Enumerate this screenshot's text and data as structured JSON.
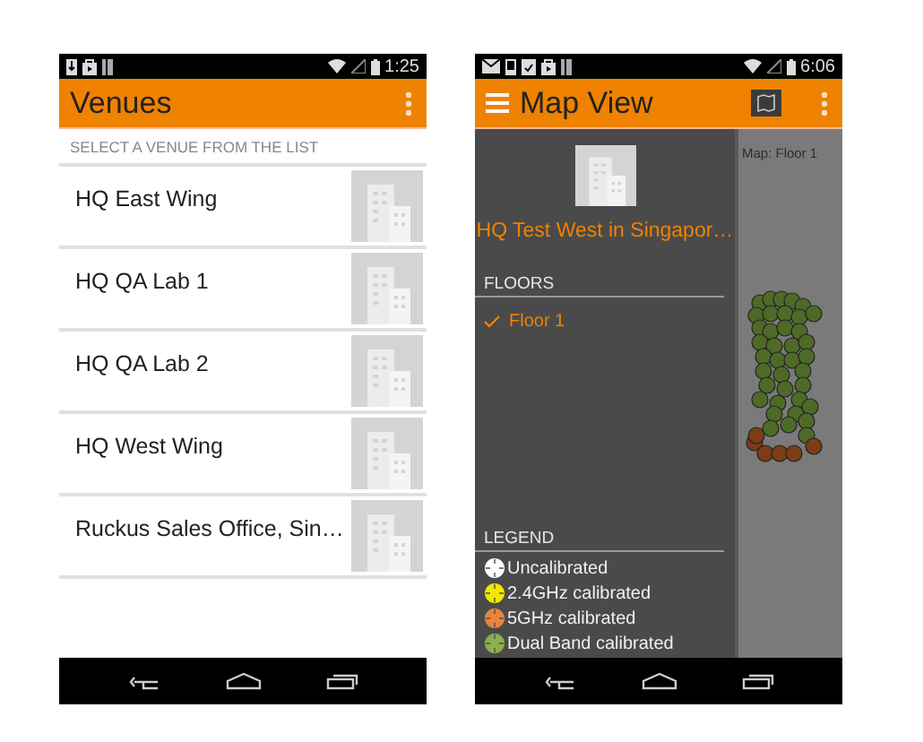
{
  "screens": [
    {
      "kind": "venue-list",
      "status_bar": {
        "time": "1:25"
      },
      "app_bar": {
        "title": "Venues"
      },
      "subtitle": "SELECT A VENUE FROM THE LIST",
      "venues": [
        {
          "name": "HQ East Wing"
        },
        {
          "name": "HQ QA Lab 1"
        },
        {
          "name": "HQ QA Lab 2"
        },
        {
          "name": "HQ West Wing"
        },
        {
          "name": "Ruckus Sales Office, Sin…"
        }
      ]
    },
    {
      "kind": "map-view",
      "status_bar": {
        "time": "6:06"
      },
      "app_bar": {
        "title": "Map View"
      },
      "map_label": "Map: Floor 1",
      "drawer": {
        "venue": "HQ Test West in Singapor…",
        "floors_heading": "FLOORS",
        "floors": [
          {
            "label": "Floor 1",
            "selected": true
          }
        ],
        "legend_heading": "LEGEND",
        "legend": [
          {
            "label": "Uncalibrated",
            "color": "#ffffff"
          },
          {
            "label": "2.4GHz calibrated",
            "color": "#f2e600"
          },
          {
            "label": "5GHz calibrated",
            "color": "#e8843c"
          },
          {
            "label": "Dual Band calibrated",
            "color": "#8bb04a"
          }
        ]
      }
    }
  ]
}
